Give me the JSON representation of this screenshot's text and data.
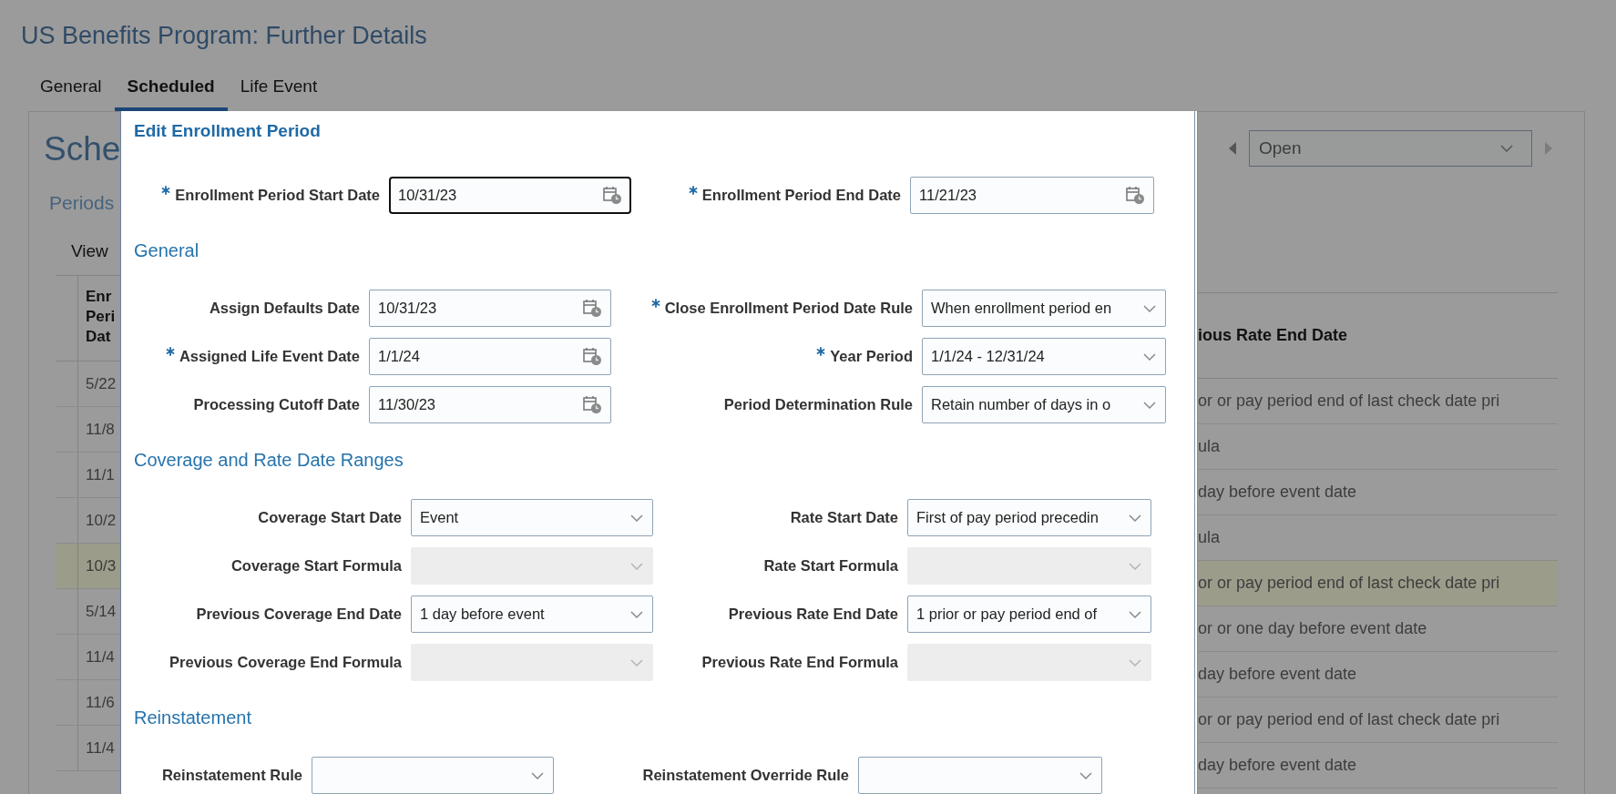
{
  "page": {
    "title": "US Benefits Program: Further Details"
  },
  "tabs": [
    {
      "label": "General",
      "selected": false
    },
    {
      "label": "Scheduled",
      "selected": true
    },
    {
      "label": "Life Event",
      "selected": false
    }
  ],
  "background": {
    "heading": "Sche",
    "subheading": "Periods",
    "toolbar_item": "View",
    "status_select": {
      "value": "Open"
    },
    "table": {
      "columns": [
        "Enr Peri Dat",
        "ious Rate End Date"
      ],
      "rows": [
        {
          "cells": [
            "5/22",
            "or or pay period end of last check date pri"
          ],
          "selected": false
        },
        {
          "cells": [
            "11/8",
            "ula"
          ],
          "selected": false
        },
        {
          "cells": [
            "11/1",
            "day before event date"
          ],
          "selected": false
        },
        {
          "cells": [
            "10/2",
            "ula"
          ],
          "selected": false
        },
        {
          "cells": [
            "10/3",
            "or or pay period end of last check date pri"
          ],
          "selected": true
        },
        {
          "cells": [
            "5/14",
            "or or one day before event date"
          ],
          "selected": false
        },
        {
          "cells": [
            "11/4",
            "day before event date"
          ],
          "selected": false
        },
        {
          "cells": [
            "11/6",
            "or or pay period end of last check date pri"
          ],
          "selected": false
        },
        {
          "cells": [
            "11/4",
            "day before event date"
          ],
          "selected": false
        }
      ]
    }
  },
  "dialog": {
    "title": "Edit Enrollment Period",
    "sections": [
      {
        "fields": [
          {
            "label": "Enrollment Period Start Date",
            "required": true,
            "kind": "date",
            "value": "10/31/23",
            "focused": true,
            "disabled": false
          },
          {
            "label": "Enrollment Period End Date",
            "required": true,
            "kind": "date",
            "value": "11/21/23",
            "focused": false,
            "disabled": false
          }
        ]
      },
      {
        "heading": "General",
        "fields": [
          {
            "label": "Assign Defaults Date",
            "required": false,
            "kind": "date",
            "value": "10/31/23",
            "focused": false,
            "disabled": false
          },
          {
            "label": "Close Enrollment Period Date Rule",
            "required": true,
            "kind": "select",
            "value": "When enrollment period en",
            "focused": false,
            "disabled": false
          },
          {
            "label": "Assigned Life Event Date",
            "required": true,
            "kind": "date",
            "value": "1/1/24",
            "focused": false,
            "disabled": false
          },
          {
            "label": "Year Period",
            "required": true,
            "kind": "select",
            "value": "1/1/24 - 12/31/24",
            "focused": false,
            "disabled": false
          },
          {
            "label": "Processing Cutoff Date",
            "required": false,
            "kind": "date",
            "value": "11/30/23",
            "focused": false,
            "disabled": false
          },
          {
            "label": "Period Determination Rule",
            "required": false,
            "kind": "select",
            "value": "Retain number of days in o",
            "focused": false,
            "disabled": false
          }
        ]
      },
      {
        "heading": "Coverage and Rate Date Ranges",
        "fields": [
          {
            "label": "Coverage Start Date",
            "required": false,
            "kind": "select",
            "value": "Event",
            "focused": false,
            "disabled": false
          },
          {
            "label": "Rate Start Date",
            "required": false,
            "kind": "select",
            "value": "First of pay period precedin",
            "focused": false,
            "disabled": false
          },
          {
            "label": "Coverage Start Formula",
            "required": false,
            "kind": "select",
            "focused": false,
            "disabled": true
          },
          {
            "label": "Rate Start Formula",
            "required": false,
            "kind": "select",
            "focused": false,
            "disabled": true
          },
          {
            "label": "Previous Coverage End Date",
            "required": false,
            "kind": "select",
            "value": "1 day before event",
            "focused": false,
            "disabled": false
          },
          {
            "label": "Previous Rate End Date",
            "required": false,
            "kind": "select",
            "value": "1 prior or pay period end of",
            "focused": false,
            "disabled": false
          },
          {
            "label": "Previous Coverage End Formula",
            "required": false,
            "kind": "select",
            "focused": false,
            "disabled": true
          },
          {
            "label": "Previous Rate End Formula",
            "required": false,
            "kind": "select",
            "focused": false,
            "disabled": true
          }
        ]
      },
      {
        "heading": "Reinstatement",
        "fields": [
          {
            "label": "Reinstatement Rule",
            "required": false,
            "kind": "select",
            "focused": false,
            "disabled": false
          },
          {
            "label": "Reinstatement Override Rule",
            "required": false,
            "kind": "select",
            "focused": false,
            "disabled": false
          }
        ]
      }
    ]
  }
}
